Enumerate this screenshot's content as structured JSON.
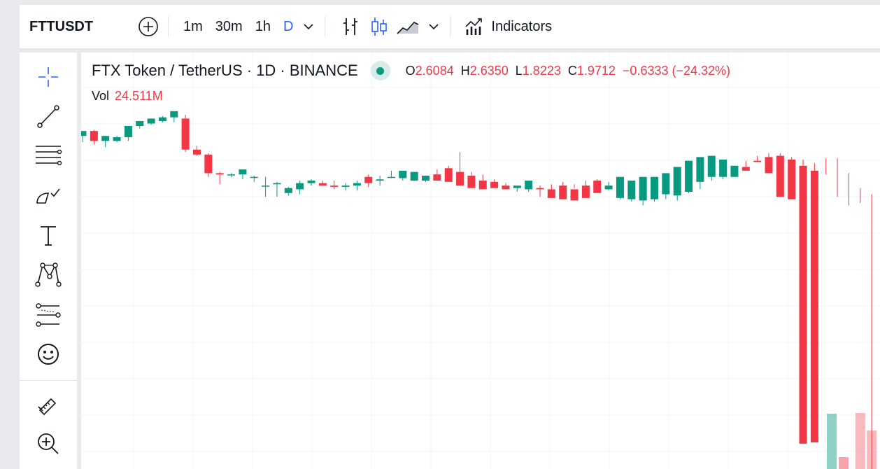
{
  "toolbar": {
    "symbol": "FTTUSDT",
    "intervals": [
      "1m",
      "30m",
      "1h",
      "D"
    ],
    "active_interval": "D",
    "indicators_label": "Indicators"
  },
  "sidebar": {
    "tools": [
      "crosshair-icon",
      "trend-line-icon",
      "fib-retracement-icon",
      "brush-icon",
      "text-icon",
      "pattern-icon",
      "forecast-icon",
      "emoji-icon",
      "ruler-icon",
      "zoom-in-icon"
    ]
  },
  "legend": {
    "title": "FTX Token / TetherUS · 1D · BINANCE",
    "o_label": "O",
    "o_value": "2.6084",
    "h_label": "H",
    "h_value": "2.6350",
    "l_label": "L",
    "l_value": "1.8223",
    "c_label": "C",
    "c_value": "1.9712",
    "change": "−0.6333 (−24.32%)",
    "vol_label": "Vol",
    "vol_value": "24.511M"
  },
  "colors": {
    "up": "#089981",
    "down": "#f23645",
    "accent": "#2962ff"
  },
  "chart_data": {
    "type": "candlestick",
    "x": [
      "1",
      "2",
      "3",
      "4",
      "5",
      "6",
      "7",
      "8",
      "9",
      "10",
      "11",
      "12",
      "13",
      "14",
      "15",
      "16",
      "17",
      "18",
      "19",
      "20",
      "21",
      "22",
      "23",
      "24",
      "25",
      "26",
      "27",
      "28",
      "29",
      "30",
      "31",
      "32",
      "33",
      "34",
      "35",
      "36",
      "37",
      "38",
      "39",
      "40",
      "41",
      "42",
      "43",
      "44",
      "45",
      "46",
      "47",
      "48",
      "49",
      "50",
      "51",
      "52",
      "53",
      "54",
      "55",
      "56",
      "57",
      "58",
      "59",
      "60",
      "61",
      "62",
      "63",
      "64",
      "65",
      "66",
      "67",
      "68",
      "69",
      "70"
    ],
    "open": [
      26.9,
      27.3,
      26.5,
      26.5,
      26.8,
      27.7,
      27.9,
      28.1,
      28.4,
      28.3,
      25.8,
      25.4,
      23.9,
      23.8,
      23.8,
      23.6,
      22.9,
      23.0,
      22.3,
      22.6,
      23.1,
      23.1,
      22.9,
      22.8,
      22.9,
      23.6,
      23.3,
      23.6,
      23.5,
      23.3,
      23.3,
      23.8,
      24.3,
      24.0,
      23.7,
      23.3,
      23.2,
      22.9,
      22.7,
      22.6,
      22.7,
      22.6,
      22.9,
      22.6,
      22.9,
      23.3,
      22.6,
      21.9,
      21.8,
      21.7,
      21.8,
      22.2,
      22.1,
      22.4,
      23.2,
      23.6,
      23.6,
      23.6,
      24.4,
      24.9,
      25.2,
      25.3,
      25.0,
      24.5,
      24.1,
      24.8,
      23.9,
      22.0,
      21.8,
      2.1
    ],
    "high": [
      27.1,
      27.4,
      26.9,
      26.9,
      27.7,
      28.1,
      28.3,
      28.5,
      28.6,
      28.6,
      26.1,
      25.5,
      24.0,
      23.9,
      24.0,
      23.7,
      23.6,
      23.2,
      22.8,
      23.3,
      23.4,
      23.3,
      23.3,
      23.1,
      23.3,
      23.8,
      23.7,
      24.1,
      24.0,
      23.8,
      23.7,
      24.2,
      24.5,
      25.6,
      24.0,
      23.8,
      23.4,
      23.1,
      22.9,
      22.8,
      22.9,
      23.0,
      23.2,
      23.0,
      23.3,
      23.4,
      23.2,
      22.1,
      22.0,
      21.8,
      22.0,
      22.5,
      22.4,
      23.2,
      23.7,
      23.9,
      24.2,
      24.5,
      24.9,
      25.3,
      25.5,
      25.5,
      25.2,
      25.0,
      24.7,
      25.1,
      25.1,
      23.9,
      22.7,
      22.2
    ],
    "low": [
      26.4,
      26.2,
      26.0,
      26.4,
      26.5,
      27.5,
      27.8,
      28.0,
      28.0,
      25.6,
      25.3,
      23.6,
      23.0,
      23.6,
      23.4,
      23.2,
      22.0,
      22.0,
      22.1,
      22.2,
      22.9,
      22.9,
      22.6,
      22.5,
      22.5,
      22.8,
      22.9,
      23.5,
      23.3,
      23.3,
      23.2,
      23.6,
      24.0,
      23.7,
      23.4,
      23.2,
      23.0,
      22.8,
      22.4,
      22.4,
      22.0,
      22.5,
      22.6,
      22.7,
      22.6,
      22.6,
      22.5,
      21.8,
      21.6,
      21.3,
      21.6,
      21.8,
      21.7,
      22.3,
      22.6,
      23.3,
      23.4,
      23.6,
      24.3,
      24.8,
      25.0,
      24.8,
      24.2,
      24.0,
      23.9,
      23.8,
      22.0,
      21.3,
      21.5,
      0.0
    ],
    "close": [
      27.3,
      26.5,
      26.9,
      26.8,
      27.7,
      28.1,
      28.3,
      28.4,
      28.9,
      25.8,
      25.4,
      23.9,
      23.8,
      23.8,
      24.2,
      23.6,
      22.9,
      23.1,
      22.7,
      23.1,
      23.3,
      22.9,
      22.8,
      22.9,
      23.1,
      23.1,
      23.4,
      23.6,
      24.1,
      24.0,
      23.7,
      23.3,
      23.2,
      22.9,
      22.7,
      22.6,
      22.7,
      22.6,
      22.9,
      23.3,
      22.6,
      21.9,
      21.8,
      21.7,
      21.9,
      22.3,
      22.9,
      23.6,
      23.3,
      23.6,
      23.6,
      23.9,
      24.4,
      24.9,
      25.2,
      25.3,
      25.0,
      24.5,
      24.1,
      24.8,
      23.9,
      22.0,
      21.8,
      2.1,
      2.2
    ],
    "title": "FTX Token / TetherUS · 1D · BINANCE"
  }
}
